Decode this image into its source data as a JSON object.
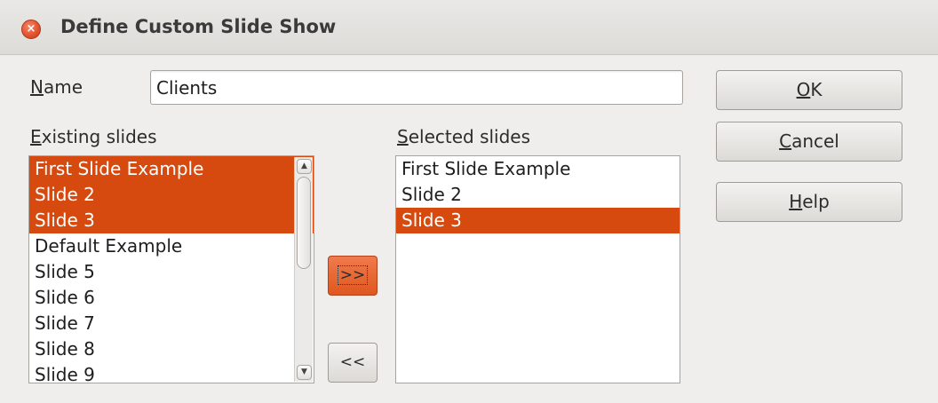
{
  "window": {
    "title": "Define Custom Slide Show",
    "close_glyph": "×"
  },
  "name_field": {
    "label_mnemonic": "N",
    "label_rest": "ame",
    "value": "Clients"
  },
  "existing": {
    "label_mnemonic": "E",
    "label_rest": "xisting slides",
    "items": [
      {
        "label": "First Slide Example",
        "selected": true
      },
      {
        "label": "Slide 2",
        "selected": true
      },
      {
        "label": "Slide 3",
        "selected": true
      },
      {
        "label": "Default Example",
        "selected": false
      },
      {
        "label": "Slide 5",
        "selected": false
      },
      {
        "label": "Slide 6",
        "selected": false
      },
      {
        "label": "Slide 7",
        "selected": false
      },
      {
        "label": "Slide 8",
        "selected": false
      },
      {
        "label": "Slide 9",
        "selected": false
      }
    ]
  },
  "selected": {
    "label_mnemonic": "S",
    "label_rest": "elected slides",
    "items": [
      {
        "label": "First Slide Example",
        "selected": false
      },
      {
        "label": "Slide 2",
        "selected": false
      },
      {
        "label": "Slide 3",
        "selected": true
      }
    ]
  },
  "buttons": {
    "ok_mnemonic": "O",
    "ok_rest": "K",
    "cancel_mnemonic": "C",
    "cancel_rest": "ancel",
    "help_mnemonic": "H",
    "help_rest": "elp",
    "add": ">>",
    "remove": "<<"
  },
  "colors": {
    "selection": "#d64a10",
    "accent_button": "#e0571f"
  },
  "icons": {
    "close": "close-icon",
    "scroll_up": "chevron-up-icon",
    "scroll_down": "chevron-down-icon"
  }
}
